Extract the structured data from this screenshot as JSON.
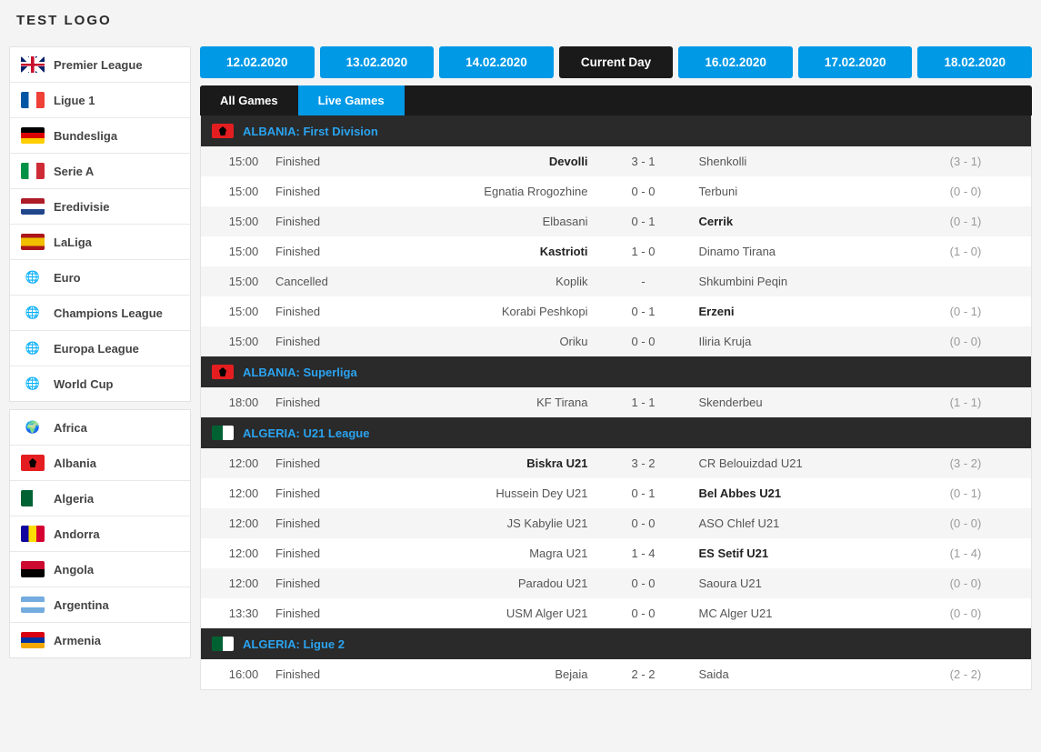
{
  "logo": "TEST LOGO",
  "sidebar": {
    "leagues": [
      {
        "label": "Premier League",
        "flag": "uk"
      },
      {
        "label": "Ligue 1",
        "flag": "fr"
      },
      {
        "label": "Bundesliga",
        "flag": "de"
      },
      {
        "label": "Serie A",
        "flag": "it"
      },
      {
        "label": "Eredivisie",
        "flag": "nl"
      },
      {
        "label": "LaLiga",
        "flag": "es"
      },
      {
        "label": "Euro",
        "flag": "world"
      },
      {
        "label": "Champions League",
        "flag": "world"
      },
      {
        "label": "Europa League",
        "flag": "world"
      },
      {
        "label": "World Cup",
        "flag": "world"
      }
    ],
    "countries": [
      {
        "label": "Africa",
        "flag": "af"
      },
      {
        "label": "Albania",
        "flag": "al"
      },
      {
        "label": "Algeria",
        "flag": "dz"
      },
      {
        "label": "Andorra",
        "flag": "ad"
      },
      {
        "label": "Angola",
        "flag": "ao"
      },
      {
        "label": "Argentina",
        "flag": "ar"
      },
      {
        "label": "Armenia",
        "flag": "am"
      }
    ]
  },
  "dates": [
    {
      "label": "12.02.2020",
      "active": false
    },
    {
      "label": "13.02.2020",
      "active": false
    },
    {
      "label": "14.02.2020",
      "active": false
    },
    {
      "label": "Current Day",
      "active": true
    },
    {
      "label": "16.02.2020",
      "active": false
    },
    {
      "label": "17.02.2020",
      "active": false
    },
    {
      "label": "18.02.2020",
      "active": false
    }
  ],
  "tabs": [
    {
      "label": "All Games",
      "active": false
    },
    {
      "label": "Live Games",
      "active": true
    }
  ],
  "groups": [
    {
      "country": "ALBANIA:",
      "competition": "First Division",
      "flag": "al",
      "matches": [
        {
          "time": "15:00",
          "status": "Finished",
          "home": "Devolli",
          "score": "3 - 1",
          "away": "Shenkolli",
          "ht": "(3 - 1)",
          "winner": "home"
        },
        {
          "time": "15:00",
          "status": "Finished",
          "home": "Egnatia Rrogozhine",
          "score": "0 - 0",
          "away": "Terbuni",
          "ht": "(0 - 0)",
          "winner": ""
        },
        {
          "time": "15:00",
          "status": "Finished",
          "home": "Elbasani",
          "score": "0 - 1",
          "away": "Cerrik",
          "ht": "(0 - 1)",
          "winner": "away"
        },
        {
          "time": "15:00",
          "status": "Finished",
          "home": "Kastrioti",
          "score": "1 - 0",
          "away": "Dinamo Tirana",
          "ht": "(1 - 0)",
          "winner": "home"
        },
        {
          "time": "15:00",
          "status": "Cancelled",
          "home": "Koplik",
          "score": "-",
          "away": "Shkumbini Peqin",
          "ht": "",
          "winner": ""
        },
        {
          "time": "15:00",
          "status": "Finished",
          "home": "Korabi Peshkopi",
          "score": "0 - 1",
          "away": "Erzeni",
          "ht": "(0 - 1)",
          "winner": "away"
        },
        {
          "time": "15:00",
          "status": "Finished",
          "home": "Oriku",
          "score": "0 - 0",
          "away": "Iliria Kruja",
          "ht": "(0 - 0)",
          "winner": ""
        }
      ]
    },
    {
      "country": "ALBANIA:",
      "competition": "Superliga",
      "flag": "al",
      "matches": [
        {
          "time": "18:00",
          "status": "Finished",
          "home": "KF Tirana",
          "score": "1 - 1",
          "away": "Skenderbeu",
          "ht": "(1 - 1)",
          "winner": ""
        }
      ]
    },
    {
      "country": "ALGERIA:",
      "competition": "U21 League",
      "flag": "dz",
      "matches": [
        {
          "time": "12:00",
          "status": "Finished",
          "home": "Biskra U21",
          "score": "3 - 2",
          "away": "CR Belouizdad U21",
          "ht": "(3 - 2)",
          "winner": "home"
        },
        {
          "time": "12:00",
          "status": "Finished",
          "home": "Hussein Dey U21",
          "score": "0 - 1",
          "away": "Bel Abbes U21",
          "ht": "(0 - 1)",
          "winner": "away"
        },
        {
          "time": "12:00",
          "status": "Finished",
          "home": "JS Kabylie U21",
          "score": "0 - 0",
          "away": "ASO Chlef U21",
          "ht": "(0 - 0)",
          "winner": ""
        },
        {
          "time": "12:00",
          "status": "Finished",
          "home": "Magra U21",
          "score": "1 - 4",
          "away": "ES Setif U21",
          "ht": "(1 - 4)",
          "winner": "away"
        },
        {
          "time": "12:00",
          "status": "Finished",
          "home": "Paradou U21",
          "score": "0 - 0",
          "away": "Saoura U21",
          "ht": "(0 - 0)",
          "winner": ""
        },
        {
          "time": "13:30",
          "status": "Finished",
          "home": "USM Alger U21",
          "score": "0 - 0",
          "away": "MC Alger U21",
          "ht": "(0 - 0)",
          "winner": ""
        }
      ]
    },
    {
      "country": "ALGERIA:",
      "competition": "Ligue 2",
      "flag": "dz",
      "matches": [
        {
          "time": "16:00",
          "status": "Finished",
          "home": "Bejaia",
          "score": "2 - 2",
          "away": "Saida",
          "ht": "(2 - 2)",
          "winner": ""
        }
      ]
    }
  ]
}
